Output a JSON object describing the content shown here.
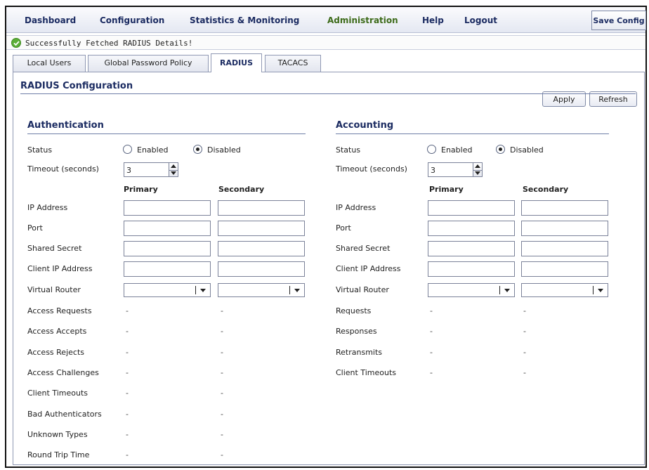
{
  "nav": {
    "items": [
      "Dashboard",
      "Configuration",
      "Statistics & Monitoring",
      "Administration",
      "Help",
      "Logout"
    ],
    "active": "Administration",
    "save_config": "Save Config"
  },
  "status": {
    "message": "Successfully Fetched RADIUS Details!",
    "icon": "check-icon"
  },
  "tabs": [
    "Local Users",
    "Global Password Policy",
    "RADIUS",
    "TACACS"
  ],
  "active_tab": "RADIUS",
  "panel": {
    "title": "RADIUS Configuration",
    "apply": "Apply",
    "refresh": "Refresh"
  },
  "authentication": {
    "title": "Authentication",
    "status_label": "Status",
    "enabled_label": "Enabled",
    "disabled_label": "Disabled",
    "status_value": "Disabled",
    "timeout_label": "Timeout (seconds)",
    "timeout_value": "3",
    "primary": "Primary",
    "secondary": "Secondary",
    "fields": [
      "IP Address",
      "Port",
      "Shared Secret",
      "Client IP Address"
    ],
    "virtual_router": "Virtual Router",
    "stats": [
      {
        "label": "Access Requests",
        "primary": "-",
        "secondary": "-"
      },
      {
        "label": "Access Accepts",
        "primary": "-",
        "secondary": "-"
      },
      {
        "label": "Access Rejects",
        "primary": "-",
        "secondary": "-"
      },
      {
        "label": "Access Challenges",
        "primary": "-",
        "secondary": "-"
      },
      {
        "label": "Client Timeouts",
        "primary": "-",
        "secondary": "-"
      },
      {
        "label": "Bad Authenticators",
        "primary": "-",
        "secondary": "-"
      },
      {
        "label": "Unknown Types",
        "primary": "-",
        "secondary": "-"
      },
      {
        "label": "Round Trip Time",
        "primary": "-",
        "secondary": "-"
      }
    ]
  },
  "accounting": {
    "title": "Accounting",
    "status_label": "Status",
    "enabled_label": "Enabled",
    "disabled_label": "Disabled",
    "status_value": "Disabled",
    "timeout_label": "Timeout (seconds)",
    "timeout_value": "3",
    "primary": "Primary",
    "secondary": "Secondary",
    "fields": [
      "IP Address",
      "Port",
      "Shared Secret",
      "Client IP Address"
    ],
    "virtual_router": "Virtual Router",
    "stats": [
      {
        "label": "Requests",
        "primary": "-",
        "secondary": "-"
      },
      {
        "label": "Responses",
        "primary": "-",
        "secondary": "-"
      },
      {
        "label": "Retransmits",
        "primary": "-",
        "secondary": "-"
      },
      {
        "label": "Client Timeouts",
        "primary": "-",
        "secondary": "-"
      }
    ]
  },
  "colors": {
    "nav_text": "#1c2c62",
    "nav_active": "#3d6b1a",
    "success": "#5cae38"
  }
}
